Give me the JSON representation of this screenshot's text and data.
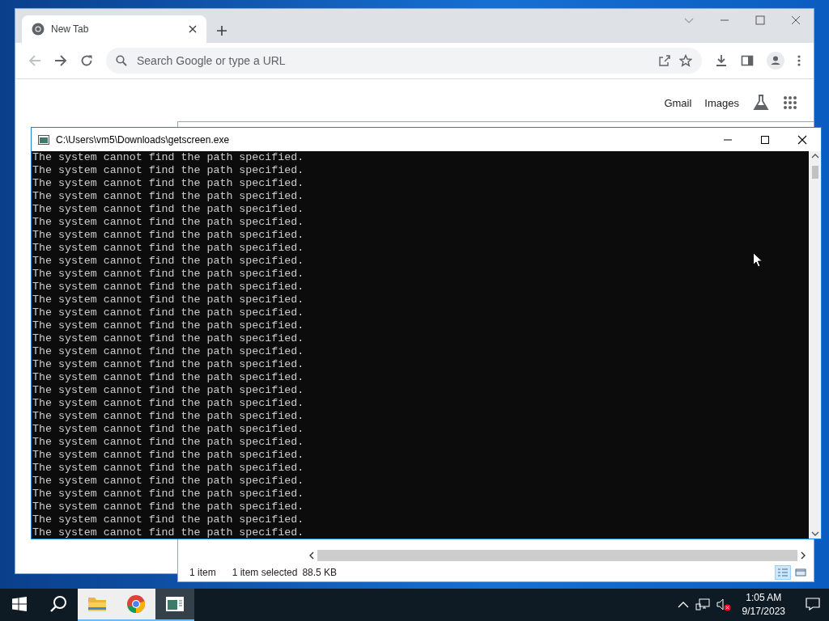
{
  "browser": {
    "tabs": [
      {
        "title": "New Tab",
        "selected": true
      }
    ],
    "omnibox": {
      "placeholder": "Search Google or type a URL"
    },
    "header_links": [
      "Gmail",
      "Images"
    ]
  },
  "file_explorer": {
    "status_bar": {
      "item_count": "1 item",
      "selection": "1 item selected",
      "size": "88.5 KB"
    },
    "views": [
      {
        "kind": "details",
        "selected": true
      },
      {
        "kind": "thumbnails",
        "selected": false
      }
    ]
  },
  "console": {
    "title": "C:\\Users\\vm5\\Downloads\\getscreen.exe",
    "lines": [
      "The system cannot find the path specified.",
      "The system cannot find the path specified.",
      "The system cannot find the path specified.",
      "The system cannot find the path specified.",
      "The system cannot find the path specified.",
      "The system cannot find the path specified.",
      "The system cannot find the path specified.",
      "The system cannot find the path specified.",
      "The system cannot find the path specified.",
      "The system cannot find the path specified.",
      "The system cannot find the path specified.",
      "The system cannot find the path specified.",
      "The system cannot find the path specified.",
      "The system cannot find the path specified.",
      "The system cannot find the path specified.",
      "The system cannot find the path specified.",
      "The system cannot find the path specified.",
      "The system cannot find the path specified.",
      "The system cannot find the path specified.",
      "The system cannot find the path specified.",
      "The system cannot find the path specified.",
      "The system cannot find the path specified.",
      "The system cannot find the path specified.",
      "The system cannot find the path specified.",
      "The system cannot find the path specified.",
      "The system cannot find the path specified.",
      "The system cannot find the path specified.",
      "The system cannot find the path specified.",
      "The system cannot find the path specified.",
      "The system cannot find the path specified."
    ]
  },
  "taskbar": {
    "apps": [
      {
        "kind": "explorer",
        "selected": false
      },
      {
        "kind": "chrome",
        "selected": false
      },
      {
        "kind": "console",
        "selected": true
      }
    ],
    "clock": {
      "time": "1:05 AM",
      "date": "9/17/2023"
    }
  }
}
